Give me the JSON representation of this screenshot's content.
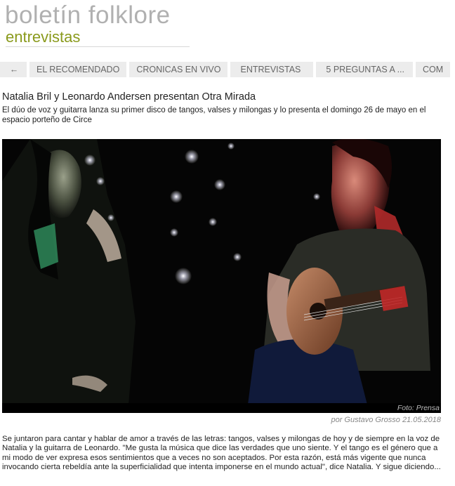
{
  "header": {
    "site_title": "boletín folklore",
    "section": "entrevistas"
  },
  "nav": {
    "back_icon": "←",
    "items": [
      {
        "label": "EL RECOMENDADO"
      },
      {
        "label": "CRONICAS EN VIVO"
      },
      {
        "label": "ENTREVISTAS"
      },
      {
        "label": "5 PREGUNTAS A ..."
      },
      {
        "label": "COM"
      }
    ]
  },
  "article": {
    "title": "Natalia Bril y Leonardo Andersen presentan Otra Mirada",
    "dek": "El dúo de voz y guitarra lanza su primer disco de tangos, valses y milongas y lo presenta el domingo 26 de mayo en el espacio porteño de Circe",
    "photo_credit": "Foto: Prensa",
    "byline": "por Gustavo Grosso 21.05.2018",
    "body": "Se juntaron para cantar y hablar de amor a través de las letras: tangos, valses y milongas de hoy y de siempre en la voz de Natalia y la guitarra de Leonardo. \"Me gusta la música que dice las verdades que uno siente. Y el tango es el género que a mi modo de ver expresa esos sentimientos que a veces no son aceptados. Por esta razón, está más vigente que nunca invocando cierta rebeldía ante la superficialidad que intenta imponerse en el mundo actual\", dice Natalia. Y sigue diciendo..."
  },
  "colors": {
    "section_green": "#8a9a1c",
    "title_gray": "#b0b0b0",
    "nav_bg": "#ececec"
  }
}
